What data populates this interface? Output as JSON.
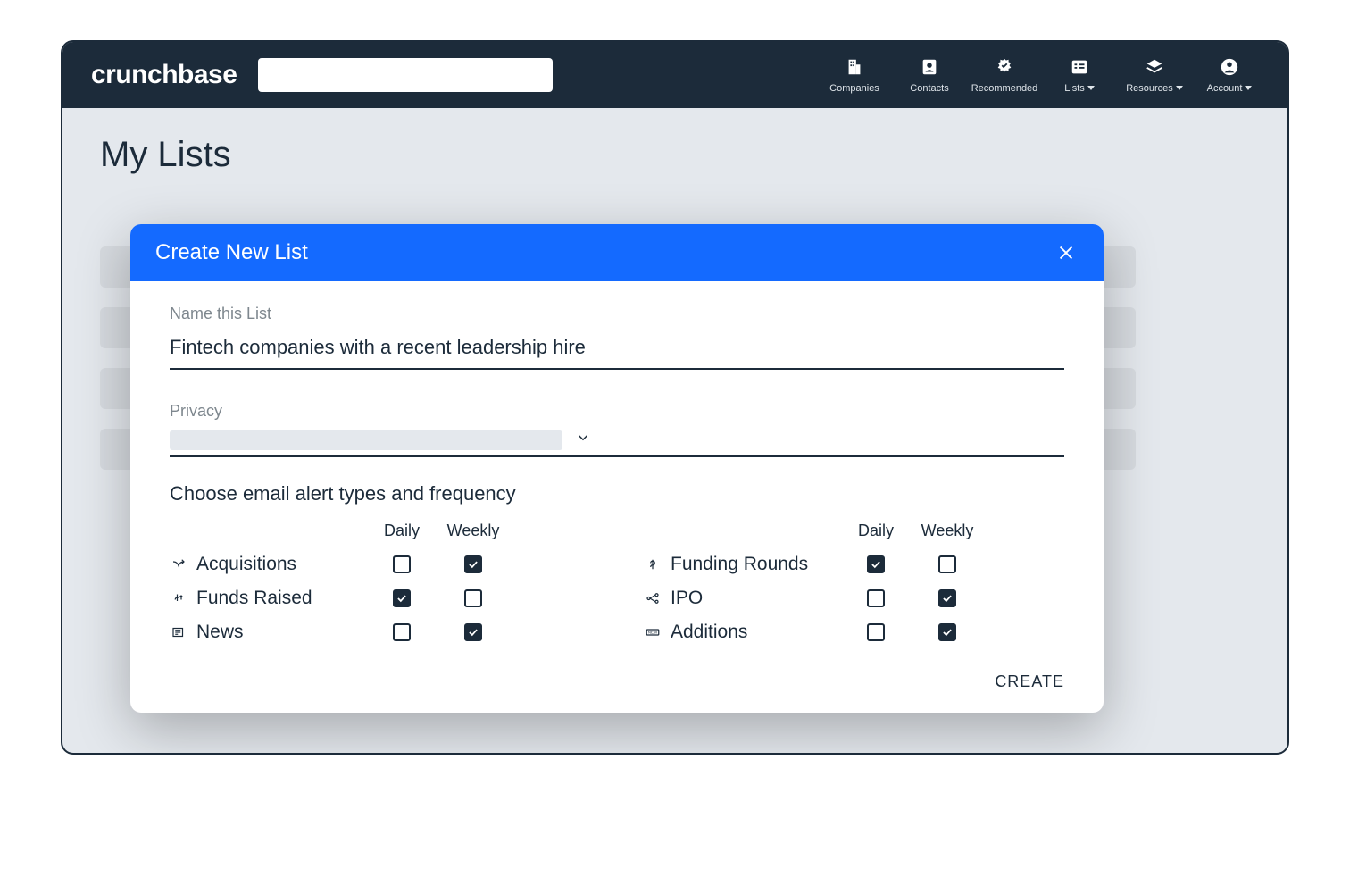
{
  "brand": "crunchbase",
  "nav": [
    {
      "label": "Companies",
      "icon": "building",
      "dropdown": false
    },
    {
      "label": "Contacts",
      "icon": "contact",
      "dropdown": false
    },
    {
      "label": "Recommended",
      "icon": "badge",
      "dropdown": false
    },
    {
      "label": "Lists",
      "icon": "list",
      "dropdown": true
    },
    {
      "label": "Resources",
      "icon": "layers",
      "dropdown": true
    },
    {
      "label": "Account",
      "icon": "account",
      "dropdown": true
    }
  ],
  "page": {
    "title": "My Lists"
  },
  "modal": {
    "title": "Create New List",
    "name_label": "Name this List",
    "name_value": "Fintech companies with a recent leadership hire",
    "privacy_label": "Privacy",
    "alerts_heading": "Choose email alert types and frequency",
    "freq": {
      "daily": "Daily",
      "weekly": "Weekly"
    },
    "left": [
      {
        "label": "Acquisitions",
        "icon": "merge",
        "daily": false,
        "weekly": true
      },
      {
        "label": "Funds Raised",
        "icon": "dollar-up",
        "daily": true,
        "weekly": false
      },
      {
        "label": "News",
        "icon": "news",
        "daily": false,
        "weekly": true
      }
    ],
    "right": [
      {
        "label": "Funding Rounds",
        "icon": "dollar",
        "daily": true,
        "weekly": false
      },
      {
        "label": "IPO",
        "icon": "network",
        "daily": false,
        "weekly": true
      },
      {
        "label": "Additions",
        "icon": "new",
        "daily": false,
        "weekly": true
      }
    ],
    "create_label": "CREATE"
  }
}
